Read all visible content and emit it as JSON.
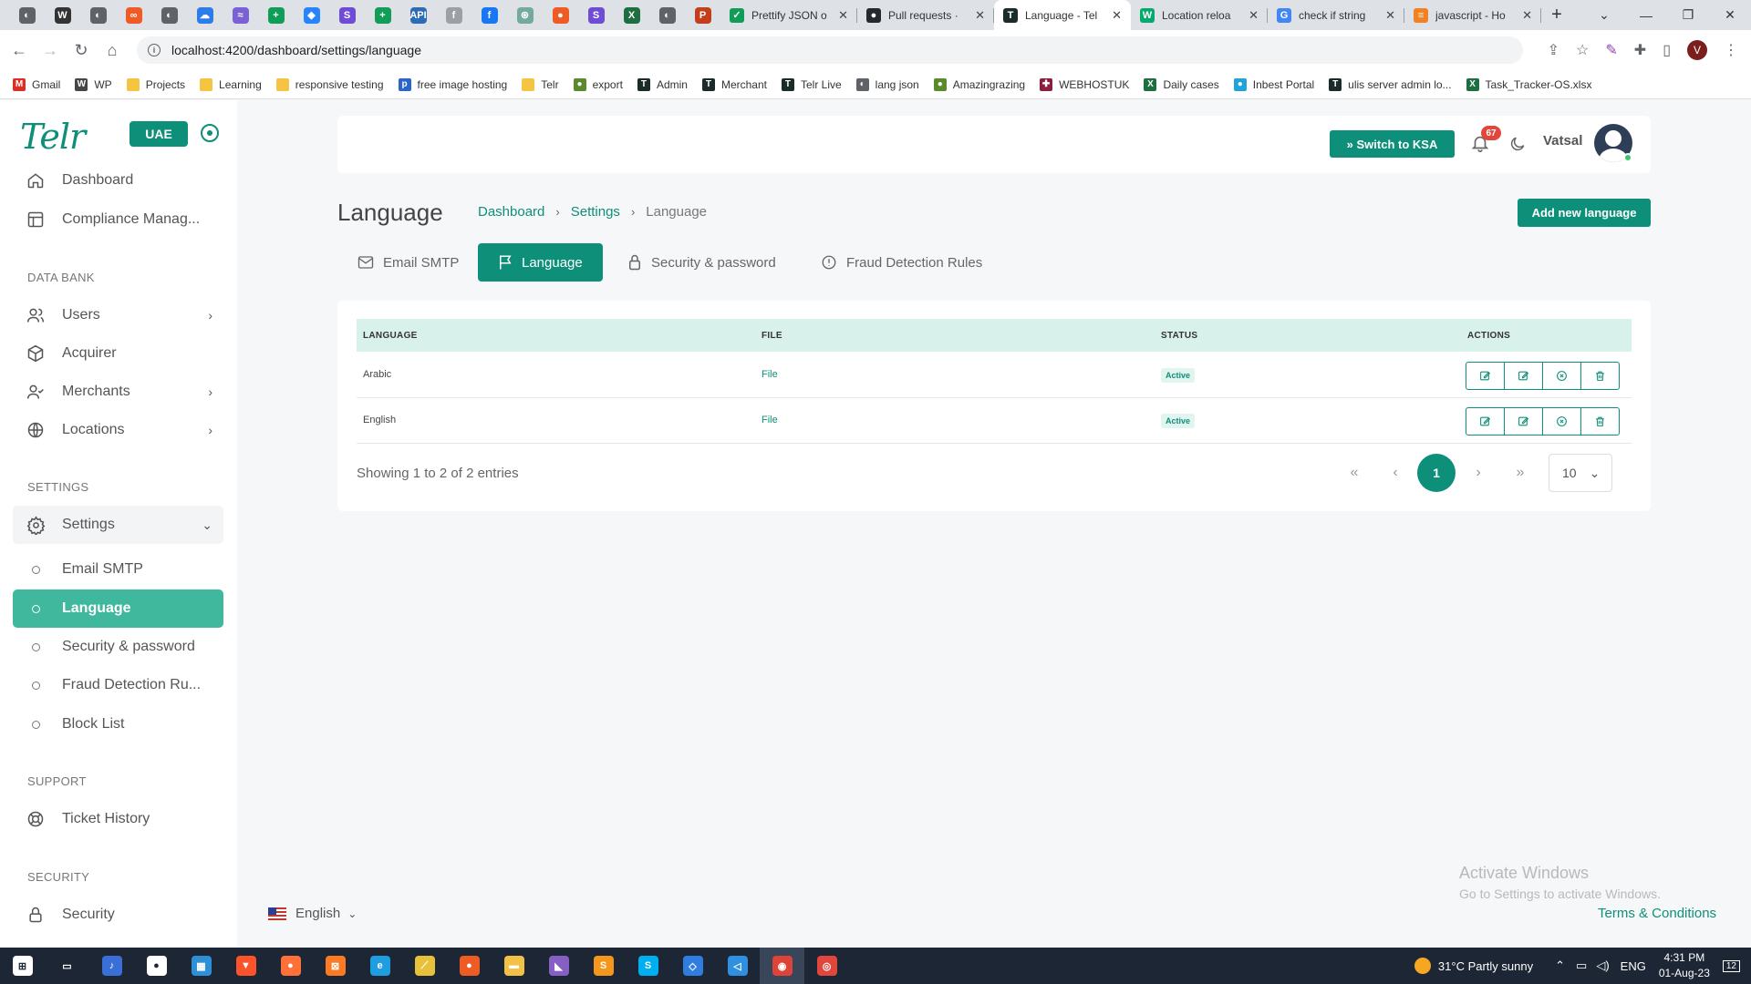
{
  "browser": {
    "pinned_tabs": [
      {
        "icon": "chrome-icon",
        "color": "#5f6368",
        "glyph": "◐"
      },
      {
        "icon": "wordpress-icon",
        "color": "#333333",
        "glyph": "W"
      },
      {
        "icon": "chrome-icon",
        "color": "#5f6368",
        "glyph": "◐"
      },
      {
        "icon": "postman-icon",
        "color": "#ef5b25",
        "glyph": "∞"
      },
      {
        "icon": "chrome-icon",
        "color": "#5f6368",
        "glyph": "◐"
      },
      {
        "icon": "cloud-icon",
        "color": "#2b7de9",
        "glyph": "☁"
      },
      {
        "icon": "onenote-icon",
        "color": "#7b61d6",
        "glyph": "≈"
      },
      {
        "icon": "sheets-icon",
        "color": "#0f9d58",
        "glyph": "+"
      },
      {
        "icon": "jira-icon",
        "color": "#2684ff",
        "glyph": "◆"
      },
      {
        "icon": "s-app-icon",
        "color": "#6f4cd6",
        "glyph": "S"
      },
      {
        "icon": "sheets-icon",
        "color": "#0f9d58",
        "glyph": "+"
      },
      {
        "icon": "api-icon",
        "color": "#2d6cb5",
        "glyph": "API"
      },
      {
        "icon": "facebook-icon",
        "color": "#9aa0a6",
        "glyph": "f"
      },
      {
        "icon": "facebook-icon",
        "color": "#1877f2",
        "glyph": "f"
      },
      {
        "icon": "chatgpt-icon",
        "color": "#74aa9c",
        "glyph": "⊛"
      },
      {
        "icon": "postman-icon",
        "color": "#ef5b25",
        "glyph": "●"
      },
      {
        "icon": "s-app-icon",
        "color": "#6f4cd6",
        "glyph": "S"
      },
      {
        "icon": "excel-icon",
        "color": "#1d6f42",
        "glyph": "X"
      },
      {
        "icon": "chrome-icon",
        "color": "#5f6368",
        "glyph": "◐"
      },
      {
        "icon": "powerpoint-icon",
        "color": "#c43e1c",
        "glyph": "P"
      }
    ],
    "tabs": [
      {
        "title": "Prettify JSON o",
        "icon": "jsonformatter-icon",
        "color": "#0f9d58",
        "glyph": "✓",
        "active": false
      },
      {
        "title": "Pull requests ·",
        "icon": "github-icon",
        "color": "#24292f",
        "glyph": "●",
        "active": false
      },
      {
        "title": "Language - Tel",
        "icon": "telr-icon",
        "color": "#1b2b2a",
        "glyph": "T",
        "active": true
      },
      {
        "title": "Location reloa",
        "icon": "w3schools-icon",
        "color": "#04aa6d",
        "glyph": "W",
        "active": false
      },
      {
        "title": "check if string",
        "icon": "google-icon",
        "color": "#4285f4",
        "glyph": "G",
        "active": false
      },
      {
        "title": "javascript - Ho",
        "icon": "stackoverflow-icon",
        "color": "#f48024",
        "glyph": "≡",
        "active": false
      }
    ],
    "url": "localhost:4200/dashboard/settings/language",
    "bookmarks": [
      {
        "label": "Gmail",
        "icon": "gmail-icon",
        "color": "#d93025",
        "glyph": "M"
      },
      {
        "label": "WP",
        "icon": "wordpress-icon",
        "color": "#464646",
        "glyph": "W"
      },
      {
        "label": "Projects",
        "icon": "folder-icon",
        "color": "#f5c542",
        "glyph": ""
      },
      {
        "label": "Learning",
        "icon": "folder-icon",
        "color": "#f5c542",
        "glyph": ""
      },
      {
        "label": "responsive testing",
        "icon": "folder-icon",
        "color": "#f5c542",
        "glyph": ""
      },
      {
        "label": "free image hosting",
        "icon": "imgbb-icon",
        "color": "#2a66c9",
        "glyph": "p"
      },
      {
        "label": "Telr",
        "icon": "folder-icon",
        "color": "#f5c542",
        "glyph": ""
      },
      {
        "label": "export",
        "icon": "export-icon",
        "color": "#5a8a2b",
        "glyph": "●"
      },
      {
        "label": "Admin",
        "icon": "telr-icon",
        "color": "#1b2b2a",
        "glyph": "T"
      },
      {
        "label": "Merchant",
        "icon": "telr-icon",
        "color": "#1b2b2a",
        "glyph": "T"
      },
      {
        "label": "Telr Live",
        "icon": "telr-icon",
        "color": "#1b2b2a",
        "glyph": "T"
      },
      {
        "label": "lang json",
        "icon": "globe-icon",
        "color": "#5f6368",
        "glyph": "◐"
      },
      {
        "label": "Amazingrazing",
        "icon": "amazingrazing-icon",
        "color": "#5a8a2b",
        "glyph": "●"
      },
      {
        "label": "WEBHOSTUK",
        "icon": "uk-flag-icon",
        "color": "#8b1e3f",
        "glyph": "✚"
      },
      {
        "label": "Daily cases",
        "icon": "excel-icon",
        "color": "#1d6f42",
        "glyph": "X"
      },
      {
        "label": "Inbest Portal",
        "icon": "inbest-icon",
        "color": "#1fa3d8",
        "glyph": "●"
      },
      {
        "label": "ulis server admin lo...",
        "icon": "telr-icon",
        "color": "#1b2b2a",
        "glyph": "T"
      },
      {
        "label": "Task_Tracker-OS.xlsx",
        "icon": "excel-icon",
        "color": "#1d6f42",
        "glyph": "X"
      }
    ]
  },
  "brand": {
    "logo": "Telr",
    "accent": "#0e8f79"
  },
  "region_button": "UAE",
  "sidebar": {
    "dashboard": "Dashboard",
    "compliance": "Compliance Manag...",
    "data_bank_title": "DATA BANK",
    "users": "Users",
    "acquirer": "Acquirer",
    "merchants": "Merchants",
    "locations": "Locations",
    "settings_title": "SETTINGS",
    "settings": "Settings",
    "email_smtp": "Email SMTP",
    "language": "Language",
    "security_password": "Security & password",
    "fraud": "Fraud Detection Ru...",
    "block_list": "Block List",
    "support_title": "SUPPORT",
    "ticket_history": "Ticket History",
    "security_title": "SECURITY",
    "security": "Security"
  },
  "language_selector": "English",
  "header": {
    "switch_button": "» Switch to KSA",
    "notifications": "67",
    "user": "Vatsal"
  },
  "page": {
    "title": "Language",
    "breadcrumb": {
      "dashboard": "Dashboard",
      "settings": "Settings",
      "current": "Language"
    },
    "add_button": "Add new language",
    "tabs": {
      "email_smtp": "Email SMTP",
      "language": "Language",
      "security": "Security & password",
      "fraud": "Fraud Detection Rules"
    }
  },
  "table": {
    "headers": {
      "language": "LANGUAGE",
      "file": "FILE",
      "status": "STATUS",
      "actions": "ACTIONS"
    },
    "rows": [
      {
        "language": "Arabic",
        "file": "File",
        "status": "Active"
      },
      {
        "language": "English",
        "file": "File",
        "status": "Active"
      }
    ],
    "showing": "Showing 1 to 2 of 2 entries",
    "pagination": {
      "first": "«",
      "prev": "‹",
      "current": "1",
      "next": "›",
      "last": "»"
    },
    "page_size": "10"
  },
  "watermark": {
    "line1": "Activate Windows",
    "line2": "Go to Settings to activate Windows."
  },
  "footer_link": "Terms & Conditions",
  "taskbar": {
    "apps": [
      {
        "icon": "start-icon",
        "color": "#ffffff",
        "glyph": "⊞"
      },
      {
        "icon": "task-view-icon",
        "color": "#1c2635",
        "glyph": "▭"
      },
      {
        "icon": "app-icon",
        "color": "#3a6fd8",
        "glyph": "♪"
      },
      {
        "icon": "app-icon",
        "color": "#ffffff",
        "glyph": "●"
      },
      {
        "icon": "calculator-icon",
        "color": "#2d8fd5",
        "glyph": "▦"
      },
      {
        "icon": "brave-icon",
        "color": "#fb542b",
        "glyph": "▼"
      },
      {
        "icon": "firefox-icon",
        "color": "#ff7139",
        "glyph": "●"
      },
      {
        "icon": "xampp-icon",
        "color": "#fb7a24",
        "glyph": "⊠"
      },
      {
        "icon": "edge-icon",
        "color": "#1e9de0",
        "glyph": "e"
      },
      {
        "icon": "app-icon",
        "color": "#e8c13a",
        "glyph": "⟋"
      },
      {
        "icon": "postman-icon",
        "color": "#ef5b25",
        "glyph": "●"
      },
      {
        "icon": "file-explorer-icon",
        "color": "#f3c146",
        "glyph": "▬"
      },
      {
        "icon": "visual-studio-icon",
        "color": "#865fc5",
        "glyph": "◣"
      },
      {
        "icon": "sublime-icon",
        "color": "#f5971d",
        "glyph": "S"
      },
      {
        "icon": "skype-icon",
        "color": "#00aff0",
        "glyph": "S"
      },
      {
        "icon": "app-icon",
        "color": "#2f7de1",
        "glyph": "◇"
      },
      {
        "icon": "vscode-icon",
        "color": "#2f8fe0",
        "glyph": "◁"
      },
      {
        "icon": "chrome-icon",
        "color": "#db4437",
        "glyph": "◉",
        "active": true
      },
      {
        "icon": "app-icon",
        "color": "#e0463b",
        "glyph": "◎"
      }
    ],
    "weather": "31°C  Partly sunny",
    "lang": "ENG",
    "time": "4:31 PM",
    "date": "01-Aug-23",
    "notif": "12"
  }
}
